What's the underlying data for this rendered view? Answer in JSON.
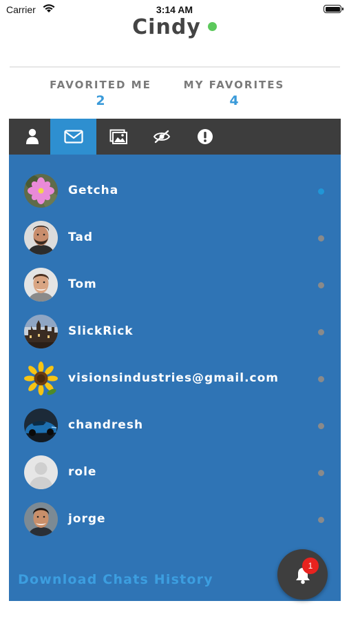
{
  "status_bar": {
    "carrier": "Carrier",
    "time": "3:14 AM"
  },
  "profile": {
    "name": "Cindy",
    "online_color": "#5cc85c"
  },
  "stats": [
    {
      "label": "FAVORITED ME",
      "count": "2"
    },
    {
      "label": "MY FAVORITES",
      "count": "4"
    }
  ],
  "tabs": [
    {
      "icon": "user-icon",
      "active": false
    },
    {
      "icon": "mail-icon",
      "active": true
    },
    {
      "icon": "photos-icon",
      "active": false
    },
    {
      "icon": "eye-slash-icon",
      "active": false
    },
    {
      "icon": "alert-icon",
      "active": false
    }
  ],
  "chats": [
    {
      "name": "Getcha",
      "avatar": "pink-flower",
      "online": true
    },
    {
      "name": "Tad",
      "avatar": "man-beard",
      "online": false
    },
    {
      "name": "Tom",
      "avatar": "man-smile",
      "online": false
    },
    {
      "name": "SlickRick",
      "avatar": "city-building",
      "online": false
    },
    {
      "name": "visionsindustries@gmail.com",
      "avatar": "sunflower",
      "online": false
    },
    {
      "name": "chandresh",
      "avatar": "blue-car",
      "online": false
    },
    {
      "name": "role",
      "avatar": "default-person",
      "online": false
    },
    {
      "name": "jorge",
      "avatar": "young-man",
      "online": false
    }
  ],
  "download_label": "Download Chats History",
  "notification": {
    "badge_count": "1"
  },
  "colors": {
    "panel_bg": "#2f74b5",
    "tab_bar_bg": "#3d3d3d",
    "tab_active_bg": "#2e8fd0",
    "accent_blue": "#3a9ad9",
    "badge_red": "#e8231f"
  }
}
